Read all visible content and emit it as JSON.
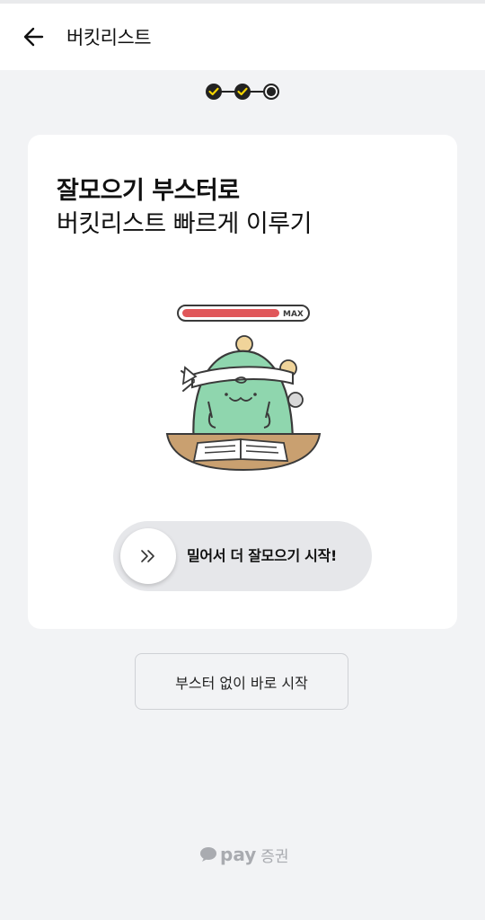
{
  "header": {
    "title": "버킷리스트",
    "back_icon": "arrow-left-icon"
  },
  "stepper": {
    "total_steps": 3,
    "current_step": 3,
    "completed_color": "#f5d500"
  },
  "card": {
    "headline_line1": "잘모으기 부스터로",
    "headline_line2": "버킷리스트 빠르게 이루기",
    "gauge_label": "MAX",
    "swipe": {
      "label": "밀어서 더 잘모으기 시작!",
      "knob_icon": "double-chevron-right-icon"
    }
  },
  "skip_button": {
    "label": "부스터 없이 바로 시작"
  },
  "brand": {
    "icon": "speech-bubble-icon",
    "name": "pay",
    "suffix": "증권"
  },
  "colors": {
    "background": "#f2f3f5",
    "card": "#ffffff",
    "accent_yellow": "#f5d500",
    "gauge_red": "#e0575a",
    "character_green": "#8fd6ae"
  }
}
